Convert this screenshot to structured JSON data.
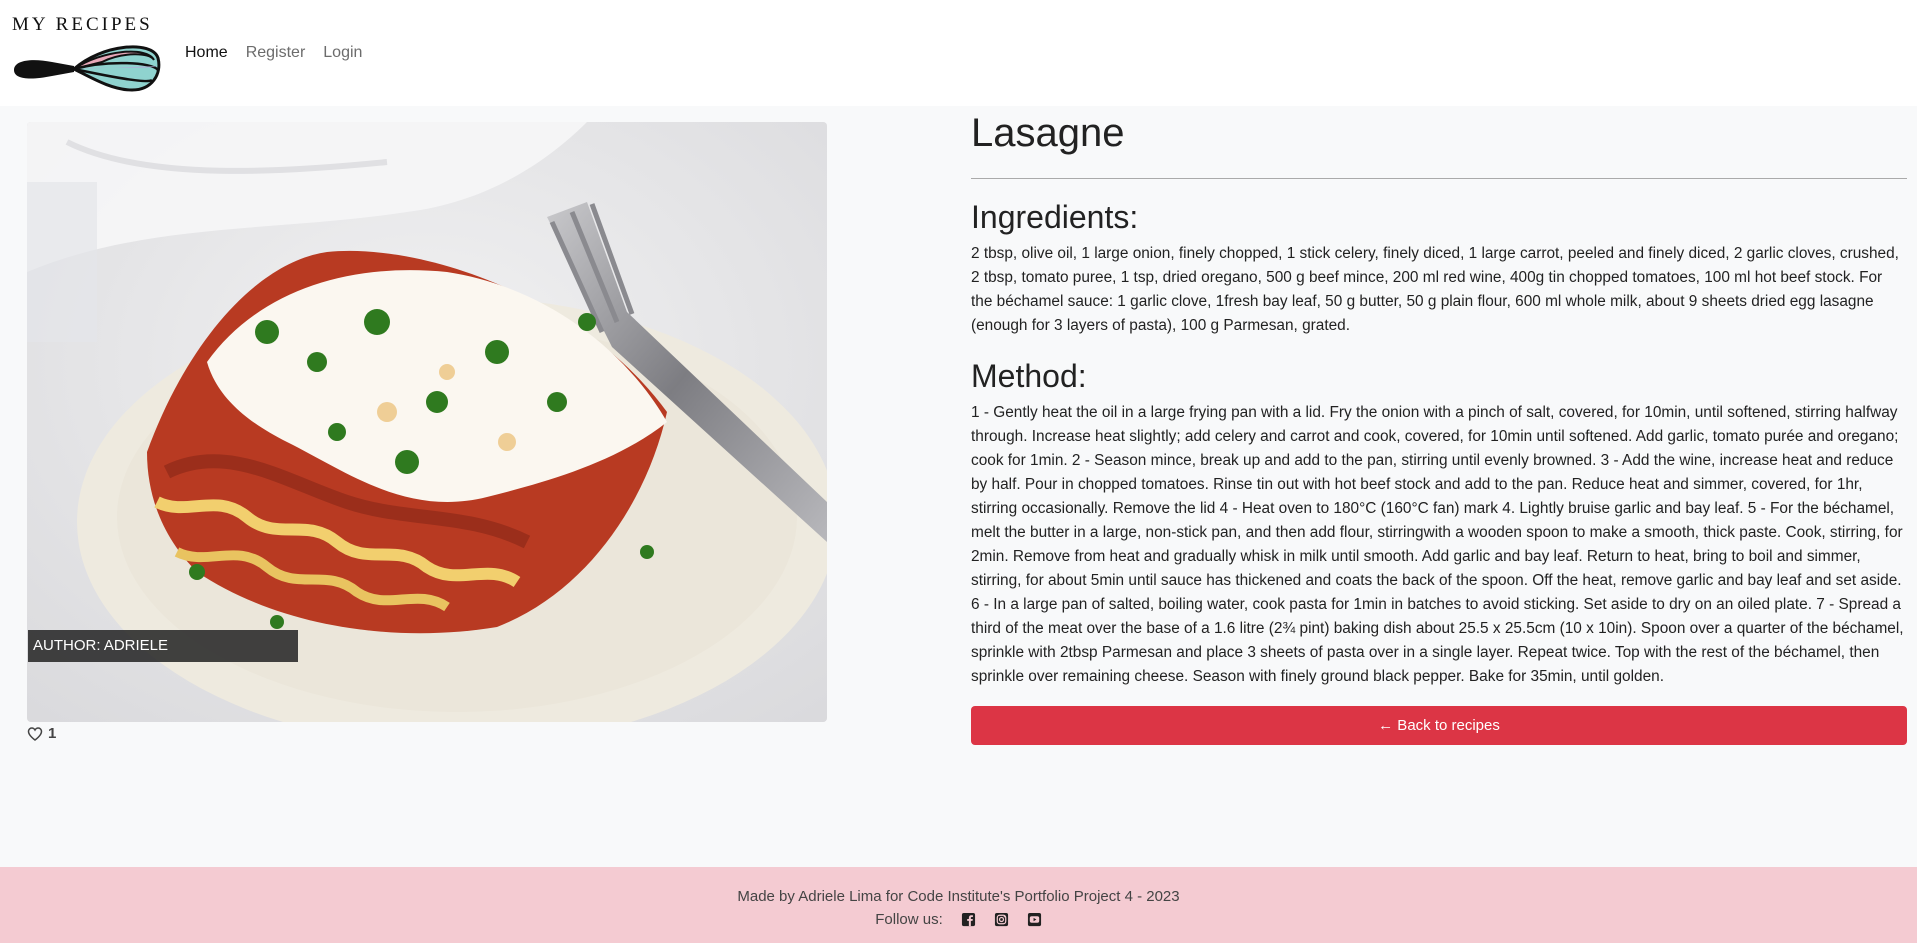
{
  "nav": {
    "brand": "MY RECIPES",
    "logo_icon": "whisk-icon",
    "links": [
      {
        "label": "Home",
        "active": true
      },
      {
        "label": "Register",
        "active": false
      },
      {
        "label": "Login",
        "active": false
      }
    ]
  },
  "recipe": {
    "image_icon": "lasagne-photo",
    "author_badge": "AUTHOR: ADRIELE",
    "like_count": "1",
    "title": "Lasagne",
    "ingredients_heading": "Ingredients:",
    "ingredients_text": "2 tbsp, olive oil, 1 large onion, finely chopped, 1 stick celery, finely diced, 1 large carrot, peeled and finely diced, 2 garlic cloves, crushed, 2 tbsp, tomato puree, 1 tsp, dried oregano, 500 g beef mince, 200 ml red wine, 400g tin chopped tomatoes, 100 ml hot beef stock. For the béchamel sauce: 1 garlic clove, 1fresh bay leaf, 50 g butter, 50 g plain flour, 600 ml whole milk, about 9 sheets dried egg lasagne (enough for 3 layers of pasta), 100 g Parmesan, grated.",
    "method_heading": "Method:",
    "method_text": "1 - Gently heat the oil in a large frying pan with a lid. Fry the onion with a pinch of salt, covered, for 10min, until softened, stirring halfway through. Increase heat slightly; add celery and carrot and cook, covered, for 10min until softened. Add garlic, tomato purée and oregano; cook for 1min. 2 - Season mince, break up and add to the pan, stirring until evenly browned. 3 - Add the wine, increase heat and reduce by half. Pour in chopped tomatoes. Rinse tin out with hot beef stock and add to the pan. Reduce heat and simmer, covered, for 1hr, stirring occasionally. Remove the lid 4 - Heat oven to 180°C (160°C fan) mark 4. Lightly bruise garlic and bay leaf. 5 - For the béchamel, melt the butter in a large, non-stick pan, and then add flour, stirringwith a wooden spoon to make a smooth, thick paste. Cook, stirring, for 2min. Remove from heat and gradually whisk in milk until smooth. Add garlic and bay leaf. Return to heat, bring to boil and simmer, stirring, for about 5min until sauce has thickened and coats the back of the spoon. Off the heat, remove garlic and bay leaf and set aside. 6 - In a large pan of salted, boiling water, cook pasta for 1min in batches to avoid sticking. Set aside to dry on an oiled plate. 7 - Spread a third of the meat over the base of a 1.6 litre (2¾ pint) baking dish about 25.5 x 25.5cm (10 x 10in). Spoon over a quarter of the béchamel, sprinkle with 2tbsp Parmesan and place 3 sheets of pasta over in a single layer. Repeat twice. Top with the rest of the béchamel, then sprinkle over remaining cheese. Season with finely ground black pepper. Bake for 35min, until golden.",
    "back_button": "← Back to recipes"
  },
  "footer": {
    "credit": "Made by Adriele Lima for Code Institute's Portfolio Project 4 - 2023",
    "follow_label": "Follow us:",
    "social_icons": [
      "facebook-icon",
      "instagram-icon",
      "youtube-icon"
    ]
  },
  "colors": {
    "accent": "#dc3545",
    "footer_bg": "#f4cbd2",
    "whisk_pink": "#e8a7b8",
    "whisk_teal": "#8fd3cf"
  }
}
